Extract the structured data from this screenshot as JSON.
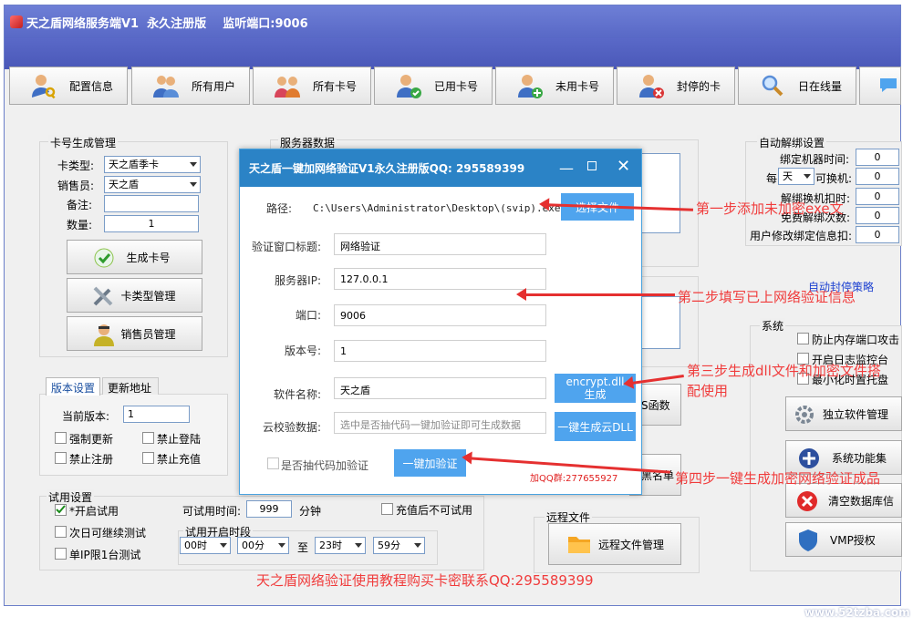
{
  "window": {
    "title": "天之盾网络服务端V1  永久注册版    监听端口:9006"
  },
  "toolbar": [
    {
      "label": "配置信息",
      "icon": "user-key-icon"
    },
    {
      "label": "所有用户",
      "icon": "users-icon"
    },
    {
      "label": "所有卡号",
      "icon": "user-group-icon"
    },
    {
      "label": "已用卡号",
      "icon": "user-check-icon"
    },
    {
      "label": "未用卡号",
      "icon": "user-add-icon"
    },
    {
      "label": "封停的卡",
      "icon": "user-block-icon"
    },
    {
      "label": "日在线量",
      "icon": "magnifier-icon"
    }
  ],
  "card_gen": {
    "group_label": "卡号生成管理",
    "type_label": "卡类型:",
    "type_value": "天之盾季卡",
    "seller_label": "销售员:",
    "seller_value": "天之盾",
    "note_label": "备注:",
    "note_value": "",
    "qty_label": "数量:",
    "qty_value": "1",
    "gen_btn": "生成卡号",
    "type_mgmt_btn": "卡类型管理",
    "seller_mgmt_btn": "销售员管理"
  },
  "version": {
    "tab_version": "版本设置",
    "tab_update": "更新地址",
    "current_label": "当前版本:",
    "current_value": "1",
    "force_update": "强制更新",
    "forbid_login": "禁止登陆",
    "forbid_register": "禁止注册",
    "forbid_recharge": "禁止充值"
  },
  "trial": {
    "group_label": "试用设置",
    "enable_trial": "*开启试用",
    "next_day": "次日可继续测试",
    "single_ip": "单IP限1台测试",
    "time_label": "可试用时间:",
    "time_value": "999",
    "time_unit": "分钟",
    "no_trial_after_recharge": "充值后不可试用",
    "period_label": "试用开启时段",
    "start_hour": "00时",
    "start_min": "00分",
    "to": "至",
    "end_hour": "23时",
    "end_min": "59分"
  },
  "server_data": {
    "group_label": "服务器数据"
  },
  "middle": {
    "func_btn": "S函数",
    "blacklist_btn": "黑名单",
    "remote_group": "远程文件",
    "remote_btn": "远程文件管理"
  },
  "unbind": {
    "group_label": "自动解绑设置",
    "bind_time_label": "绑定机器时间:",
    "bind_time_value": "0",
    "per_label": "每",
    "per_unit": "天",
    "per_suffix": "可换机:",
    "per_value": "0",
    "deduct_label": "解绑换机扣时:",
    "deduct_value": "0",
    "free_label": "免费解绑次数:",
    "free_value": "0",
    "modify_label": "用户修改绑定信息扣:",
    "modify_value": "0",
    "auto_ban_link": "自动封停策略"
  },
  "system": {
    "group_label": "系统",
    "anti_attack": "防止内存端口攻击",
    "log_monitor": "开启日志监控台",
    "minimize_tray": "最小化时置托盘",
    "independent_mgmt": "独立软件管理",
    "sys_func": "系统功能集",
    "clear_db": "清空数据库信",
    "vmp": "VMP授权"
  },
  "dialog": {
    "title": "天之盾一键加网络验证V1永久注册版QQ: 295589399",
    "path_label": "路径:",
    "path_value": "C:\\Users\\Administrator\\Desktop\\(svip).exe",
    "select_btn": "选择文件",
    "win_title_label": "验证窗口标题:",
    "win_title_value": "网络验证",
    "ip_label": "服务器IP:",
    "ip_value": "127.0.0.1",
    "port_label": "端口:",
    "port_value": "9006",
    "ver_label": "版本号:",
    "ver_value": "1",
    "soft_label": "软件名称:",
    "soft_value": "天之盾",
    "encrypt_btn_1": "encrypt.dll",
    "encrypt_btn_2": "生成",
    "cloud_label": "云校验数据:",
    "cloud_placeholder": "选中是否抽代码一键加验证即可生成数据",
    "cloud_btn": "一键生成云DLL",
    "extract_label": "是否抽代码加验证",
    "add_btn": "一键加验证",
    "qq_group": "加QQ群:277655927"
  },
  "annotations": {
    "step1": "第一步添加未加密exe文",
    "step2": "第二步填写已上网络验证信息",
    "step3_a": "第三步生成dll文件和加密文件搭",
    "step3_b": "配使用",
    "step4": "第四步一键生成加密网络验证成品",
    "footer": "天之盾网络验证使用教程购买卡密联系QQ:295589399"
  },
  "watermark": "www.52tzba.com",
  "colors": {
    "title_bar": "#5868c6",
    "dialog_title": "#2b83c6",
    "blue_button": "#4fa4ee",
    "annotation": "#f03c3c"
  }
}
